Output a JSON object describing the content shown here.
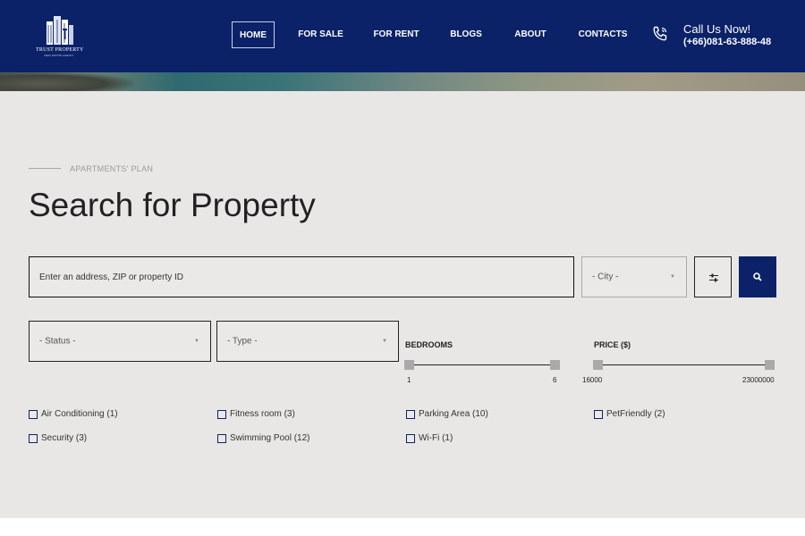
{
  "header": {
    "logo_text": "TRUST PROPERTY",
    "logo_sub": "REAL ESTATE AGENCY",
    "nav": [
      {
        "label": "HOME"
      },
      {
        "label": "FOR SALE"
      },
      {
        "label": "FOR RENT"
      },
      {
        "label": "BLOGS"
      },
      {
        "label": "ABOUT"
      },
      {
        "label": "CONTACTS"
      }
    ],
    "call_title": "Call Us Now!",
    "call_number": "(+66)081-63-888-48"
  },
  "section": {
    "eyebrow": "APARTMENTS' PLAN",
    "title": "Search for Property"
  },
  "search": {
    "placeholder": "Enter an address, ZIP or property ID",
    "city": "- City -",
    "status": "- Status -",
    "type": "- Type -"
  },
  "bedrooms": {
    "label": "BEDROOMS",
    "min": "1",
    "max": "6"
  },
  "price": {
    "label": "PRICE ($)",
    "min": "16000",
    "max": "23000000"
  },
  "amenities": [
    {
      "label": "Air Conditioning (1)"
    },
    {
      "label": "Fitness room (3)"
    },
    {
      "label": "Parking Area (10)"
    },
    {
      "label": "PetFriendly (2)"
    },
    {
      "label": "Security (3)"
    },
    {
      "label": "Swimming Pool (12)"
    },
    {
      "label": "Wi-Fi (1)"
    }
  ],
  "colors": {
    "brand_navy": "#0b2268",
    "content_bg": "#e9e7e5"
  }
}
